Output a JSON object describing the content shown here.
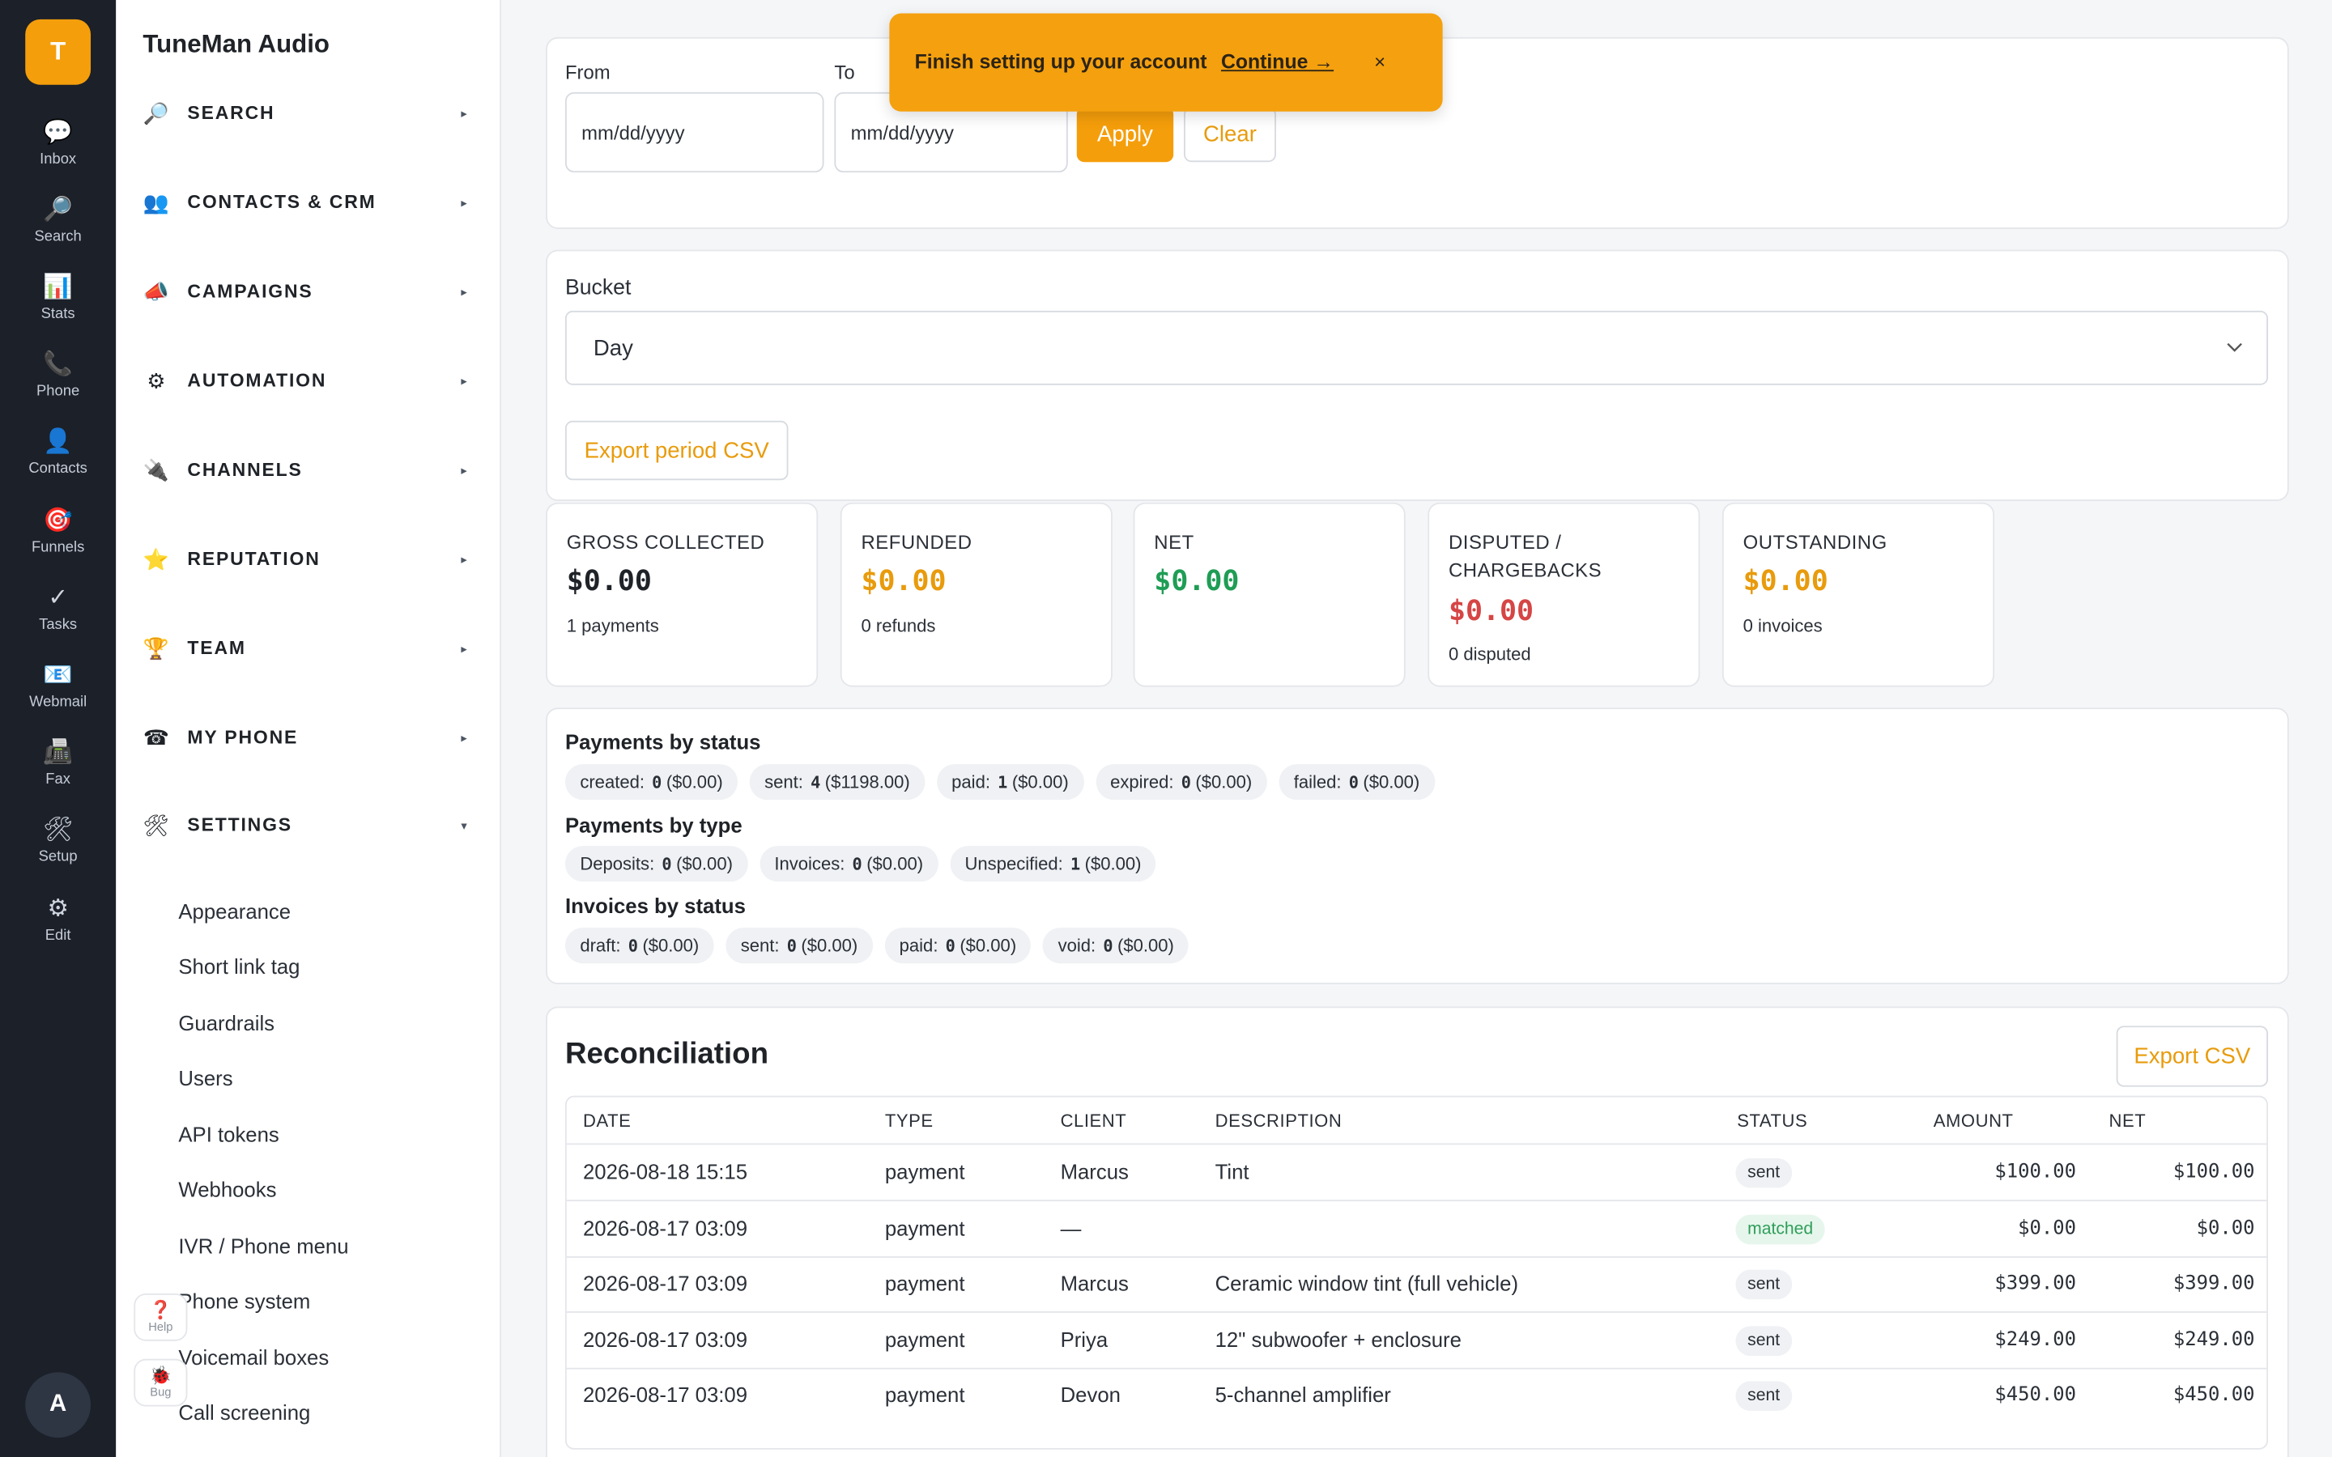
{
  "rail": {
    "logo": "T",
    "avatar": "A",
    "items": [
      {
        "label": "Inbox",
        "icon": "speech-bubble-icon",
        "glyph": "💬"
      },
      {
        "label": "Search",
        "icon": "magnifier-icon",
        "glyph": "🔎"
      },
      {
        "label": "Stats",
        "icon": "bar-chart-icon",
        "glyph": "📊"
      },
      {
        "label": "Phone",
        "icon": "phone-icon",
        "glyph": "📞"
      },
      {
        "label": "Contacts",
        "icon": "person-icon",
        "glyph": "👤"
      },
      {
        "label": "Funnels",
        "icon": "target-icon",
        "glyph": "🎯"
      },
      {
        "label": "Tasks",
        "icon": "checkmark-icon",
        "glyph": "✓"
      },
      {
        "label": "Webmail",
        "icon": "mail-icon",
        "glyph": "📧"
      },
      {
        "label": "Fax",
        "icon": "fax-icon",
        "glyph": "📠"
      },
      {
        "label": "Setup",
        "icon": "tools-icon",
        "glyph": "🛠"
      },
      {
        "label": "Edit",
        "icon": "gear-icon",
        "glyph": "⚙"
      }
    ]
  },
  "nav": {
    "brand": "TuneMan Audio",
    "sections": [
      {
        "label": "SEARCH",
        "icon": "magnifier-icon",
        "glyph": "🔎"
      },
      {
        "label": "CONTACTS & CRM",
        "icon": "people-icon",
        "glyph": "👥"
      },
      {
        "label": "CAMPAIGNS",
        "icon": "megaphone-icon",
        "glyph": "📣"
      },
      {
        "label": "AUTOMATION",
        "icon": "gear-icon",
        "glyph": "⚙"
      },
      {
        "label": "CHANNELS",
        "icon": "plug-icon",
        "glyph": "🔌"
      },
      {
        "label": "REPUTATION",
        "icon": "star-icon",
        "glyph": "⭐"
      },
      {
        "label": "TEAM",
        "icon": "trophy-icon",
        "glyph": "🏆"
      },
      {
        "label": "MY PHONE",
        "icon": "telephone-icon",
        "glyph": "☎"
      },
      {
        "label": "SETTINGS",
        "icon": "tools-icon",
        "glyph": "🛠"
      }
    ],
    "collapsed_caret": "▸",
    "expanded_caret": "▾",
    "settings_items": [
      "Appearance",
      "Short link tag",
      "Guardrails",
      "Users",
      "API tokens",
      "Webhooks",
      "IVR / Phone menu",
      "Phone system",
      "Voicemail boxes",
      "Call screening"
    ],
    "help": {
      "label": "Help",
      "glyph": "❓"
    },
    "bug": {
      "label": "Bug",
      "glyph": "🐞"
    }
  },
  "filters": {
    "from_label": "From",
    "to_label": "To",
    "from_value": "mm/dd/yyyy",
    "to_value": "mm/dd/yyyy",
    "apply_label": "Apply",
    "clear_label": "Clear"
  },
  "bucket": {
    "label": "Bucket",
    "value": "Day",
    "export_label": "Export period CSV"
  },
  "stats": [
    {
      "title": "GROSS COLLECTED",
      "value": "$0.00",
      "sub": "1 payments",
      "color": "#1f2328"
    },
    {
      "title": "REFUNDED",
      "value": "$0.00",
      "sub": "0 refunds",
      "color": "#e89b0c"
    },
    {
      "title": "NET",
      "value": "$0.00",
      "sub": "",
      "color": "#1f9d55"
    },
    {
      "title": "DISPUTED / CHARGEBACKS",
      "value": "$0.00",
      "sub": "0 disputed",
      "color": "#d64545"
    },
    {
      "title": "OUTSTANDING",
      "value": "$0.00",
      "sub": "0 invoices",
      "color": "#e89b0c"
    }
  ],
  "breakdown": {
    "payments_by_status": {
      "title": "Payments by status",
      "chips": [
        {
          "name": "created:",
          "count": "0",
          "amount": "($0.00)"
        },
        {
          "name": "sent:",
          "count": "4",
          "amount": "($1198.00)"
        },
        {
          "name": "paid:",
          "count": "1",
          "amount": "($0.00)"
        },
        {
          "name": "expired:",
          "count": "0",
          "amount": "($0.00)"
        },
        {
          "name": "failed:",
          "count": "0",
          "amount": "($0.00)"
        }
      ]
    },
    "payments_by_type": {
      "title": "Payments by type",
      "chips": [
        {
          "name": "Deposits:",
          "count": "0",
          "amount": "($0.00)"
        },
        {
          "name": "Invoices:",
          "count": "0",
          "amount": "($0.00)"
        },
        {
          "name": "Unspecified:",
          "count": "1",
          "amount": "($0.00)"
        }
      ]
    },
    "invoices_by_status": {
      "title": "Invoices by status",
      "chips": [
        {
          "name": "draft:",
          "count": "0",
          "amount": "($0.00)"
        },
        {
          "name": "sent:",
          "count": "0",
          "amount": "($0.00)"
        },
        {
          "name": "paid:",
          "count": "0",
          "amount": "($0.00)"
        },
        {
          "name": "void:",
          "count": "0",
          "amount": "($0.00)"
        }
      ]
    }
  },
  "reconciliation": {
    "title": "Reconciliation",
    "export_label": "Export CSV",
    "columns": [
      "DATE",
      "TYPE",
      "CLIENT",
      "DESCRIPTION",
      "STATUS",
      "AMOUNT",
      "NET"
    ],
    "rows": [
      {
        "date": "2026-08-18 15:15",
        "type": "payment",
        "client": "Marcus",
        "description": "Tint",
        "status": "sent",
        "amount": "$100.00",
        "net": "$100.00"
      },
      {
        "date": "2026-08-17 03:09",
        "type": "payment",
        "client": "—",
        "description": "",
        "status": "matched",
        "amount": "$0.00",
        "net": "$0.00"
      },
      {
        "date": "2026-08-17 03:09",
        "type": "payment",
        "client": "Marcus",
        "description": "Ceramic window tint (full vehicle)",
        "status": "sent",
        "amount": "$399.00",
        "net": "$399.00"
      },
      {
        "date": "2026-08-17 03:09",
        "type": "payment",
        "client": "Priya",
        "description": "12\" subwoofer + enclosure",
        "status": "sent",
        "amount": "$249.00",
        "net": "$249.00"
      },
      {
        "date": "2026-08-17 03:09",
        "type": "payment",
        "client": "Devon",
        "description": "5-channel amplifier",
        "status": "sent",
        "amount": "$450.00",
        "net": "$450.00"
      }
    ]
  },
  "toast": {
    "message": "Finish setting up your account",
    "cta": "Continue →",
    "close": "×"
  }
}
